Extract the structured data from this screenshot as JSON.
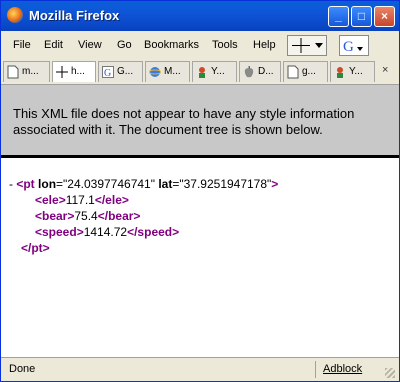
{
  "window": {
    "title": "Mozilla Firefox",
    "min_glyph": "_",
    "max_glyph": "□",
    "close_glyph": "×"
  },
  "menu": {
    "file": "File",
    "edit": "Edit",
    "view": "View",
    "go": "Go",
    "bookmarks": "Bookmarks",
    "tools": "Tools",
    "help": "Help"
  },
  "tabs": [
    {
      "label": "m...",
      "icon": "page-icon"
    },
    {
      "label": "h...",
      "icon": "crosshair-icon"
    },
    {
      "label": "G...",
      "icon": "google-icon"
    },
    {
      "label": "M...",
      "icon": "ie-icon"
    },
    {
      "label": "Y...",
      "icon": "yahoo-icon"
    },
    {
      "label": "D...",
      "icon": "apple-icon"
    },
    {
      "label": "g...",
      "icon": "page-icon"
    },
    {
      "label": "Y...",
      "icon": "yahoo-icon"
    }
  ],
  "tab_close_glyph": "×",
  "infobar": {
    "message": "This XML file does not appear to have any style information associated with it. The document tree is shown below."
  },
  "xml": {
    "collapse_marker": "-",
    "pt_open_tag": "<pt",
    "lon_attr": "lon",
    "lon_value": "=\"24.0397746741\"",
    "lat_attr": "lat",
    "lat_value": "=\"37.9251947178\"",
    "pt_open_close": ">",
    "ele_open": "<ele>",
    "ele_value": "117.1",
    "ele_close": "</ele>",
    "bear_open": "<bear>",
    "bear_value": "75.4",
    "bear_close": "</bear>",
    "speed_open": "<speed>",
    "speed_value": "1414.72",
    "speed_close": "</speed>",
    "pt_close": "</pt>"
  },
  "status": {
    "text": "Done",
    "adblock": "Adblock"
  }
}
